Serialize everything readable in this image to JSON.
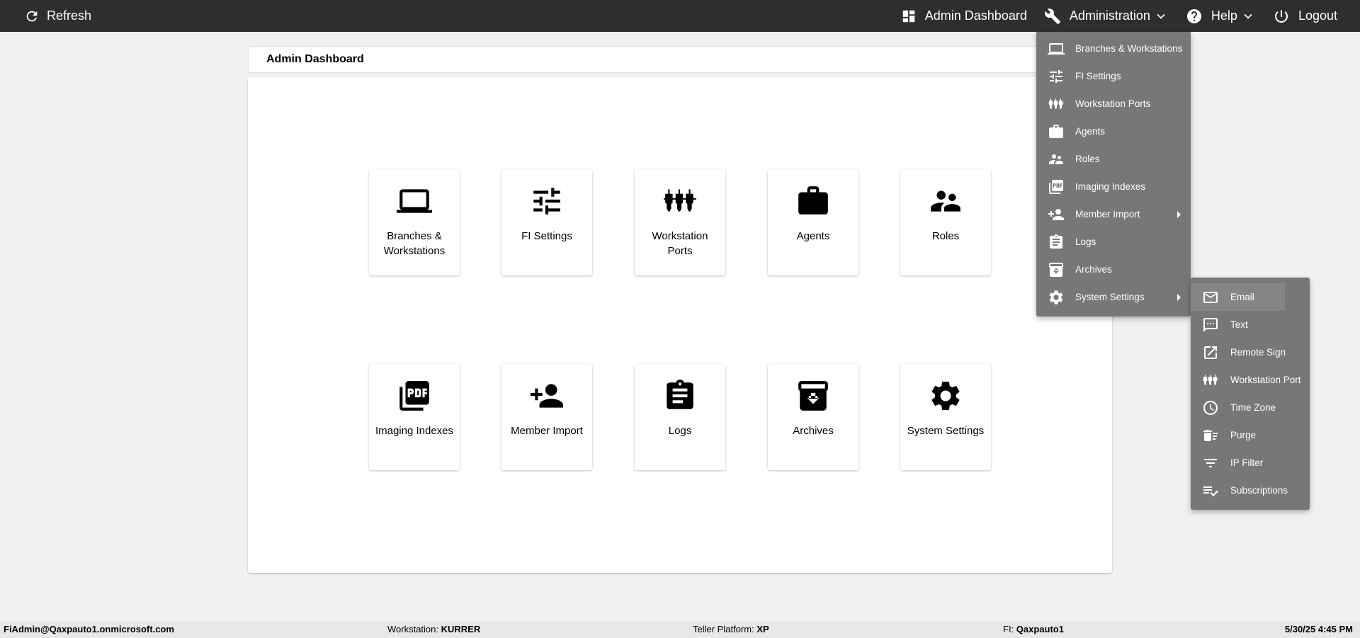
{
  "topbar": {
    "refresh_label": "Refresh",
    "admin_dashboard_label": "Admin Dashboard",
    "administration_label": "Administration",
    "help_label": "Help",
    "logout_label": "Logout"
  },
  "page": {
    "title": "Admin Dashboard"
  },
  "tiles": [
    {
      "label": "Branches & Workstations",
      "icon": "laptop-icon"
    },
    {
      "label": "FI Settings",
      "icon": "tune-icon"
    },
    {
      "label": "Workstation Ports",
      "icon": "ports-icon"
    },
    {
      "label": "Agents",
      "icon": "briefcase-icon"
    },
    {
      "label": "Roles",
      "icon": "people-icon"
    },
    {
      "label": "Imaging Indexes",
      "icon": "pdf-icon"
    },
    {
      "label": "Member Import",
      "icon": "person-add-icon"
    },
    {
      "label": "Logs",
      "icon": "clipboard-icon"
    },
    {
      "label": "Archives",
      "icon": "archive-icon"
    },
    {
      "label": "System Settings",
      "icon": "gear-icon"
    }
  ],
  "admin_menu": [
    {
      "label": "Branches & Workstations",
      "icon": "laptop-icon"
    },
    {
      "label": "FI Settings",
      "icon": "tune-icon"
    },
    {
      "label": "Workstation Ports",
      "icon": "ports-icon"
    },
    {
      "label": "Agents",
      "icon": "briefcase-icon"
    },
    {
      "label": "Roles",
      "icon": "people-icon"
    },
    {
      "label": "Imaging Indexes",
      "icon": "pdf-icon"
    },
    {
      "label": "Member Import",
      "icon": "person-add-icon",
      "submenu": true
    },
    {
      "label": "Logs",
      "icon": "clipboard-icon"
    },
    {
      "label": "Archives",
      "icon": "archive-icon"
    },
    {
      "label": "System Settings",
      "icon": "gear-icon",
      "submenu": true
    }
  ],
  "system_settings_menu": [
    {
      "label": "Email",
      "icon": "email-icon"
    },
    {
      "label": "Text",
      "icon": "message-icon"
    },
    {
      "label": "Remote Sign",
      "icon": "open-in-new-icon"
    },
    {
      "label": "Workstation Port",
      "icon": "ports-icon"
    },
    {
      "label": "Time Zone",
      "icon": "clock-icon"
    },
    {
      "label": "Purge",
      "icon": "delete-sweep-icon"
    },
    {
      "label": "IP Filter",
      "icon": "filter-icon"
    },
    {
      "label": "Subscriptions",
      "icon": "playlist-check-icon"
    }
  ],
  "footer": {
    "user": "FiAdmin@Qaxpauto1.onmicrosoft.com",
    "workstation_label": "Workstation: ",
    "workstation_value": "KURRER",
    "platform_label": "Teller Platform: ",
    "platform_value": "XP",
    "fi_label": "FI: ",
    "fi_value": "Qaxpauto1",
    "datetime": "5/30/25 4:45 PM"
  }
}
